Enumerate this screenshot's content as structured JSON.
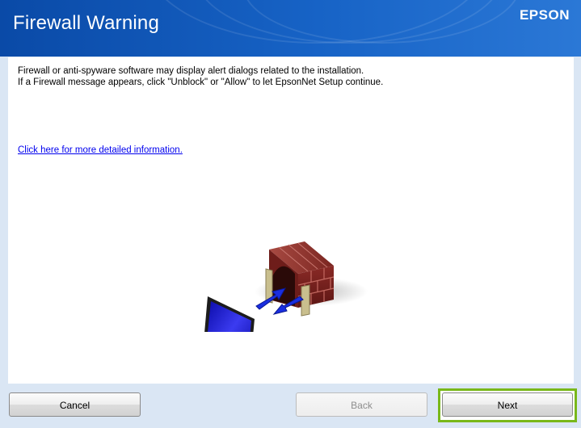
{
  "window": {
    "title": "Firewall Warning",
    "brand": "EPSON"
  },
  "body": {
    "line1": "Firewall or anti-spyware software may display alert dialogs related to the installation.",
    "line2": "If a Firewall message appears, click \"Unblock\" or \"Allow\" to let EpsonNet Setup continue.",
    "link": "Click here for more detailed information."
  },
  "buttons": {
    "cancel": "Cancel",
    "back": "Back",
    "next": "Next"
  },
  "colors": {
    "header": "#1763c6",
    "focus_border": "#79b81a",
    "link": "#0000ee"
  }
}
